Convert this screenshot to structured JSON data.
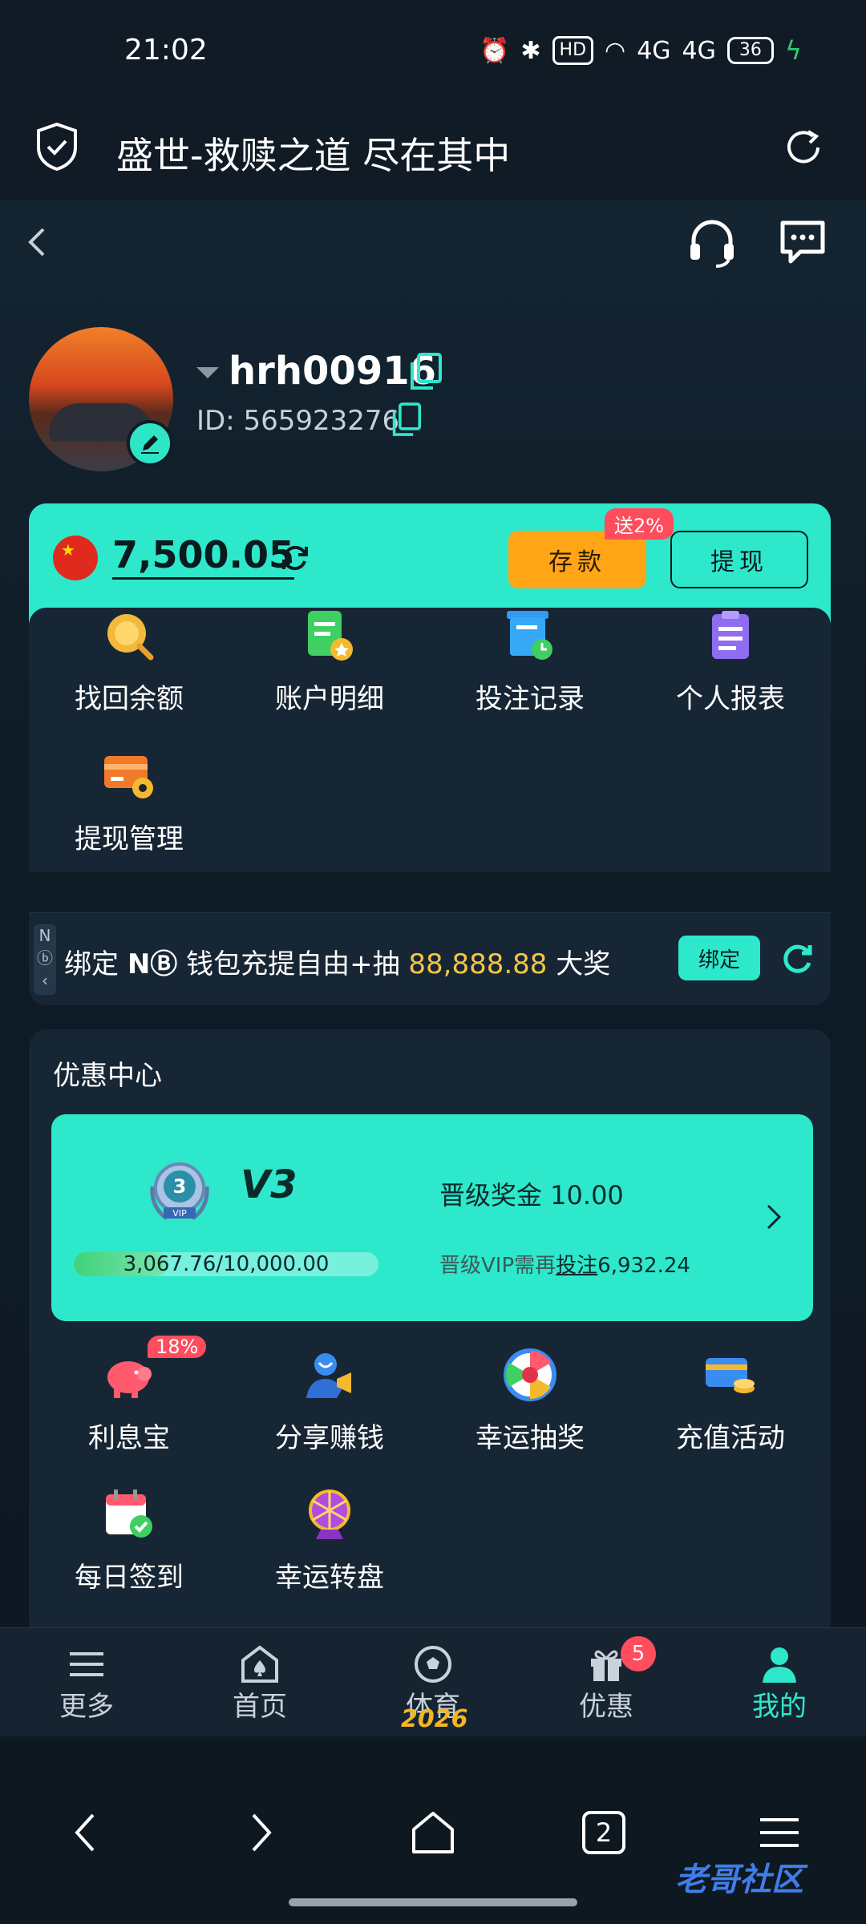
{
  "status_bar": {
    "time": "21:02",
    "hd_label": "HD",
    "signal_1": "4G",
    "signal_2": "4G",
    "battery": "36"
  },
  "browser": {
    "title": "盛世-救赎之道 尽在其中"
  },
  "user": {
    "username": "hrh00916",
    "id_text": "ID: 565923276"
  },
  "wallet": {
    "balance": "7,500.05",
    "deposit_label": "存款",
    "deposit_bonus": "送2%",
    "withdraw_label": "提现"
  },
  "menu": [
    {
      "label": "找回余额",
      "icon": "coin-search-icon"
    },
    {
      "label": "账户明细",
      "icon": "account-detail-icon"
    },
    {
      "label": "投注记录",
      "icon": "bet-record-icon"
    },
    {
      "label": "个人报表",
      "icon": "report-clipboard-icon"
    },
    {
      "label": "提现管理",
      "icon": "withdraw-card-icon"
    }
  ],
  "bind": {
    "side_text": "N",
    "prefix": "绑定 ",
    "brand": "NⒷ",
    "middle": " 钱包充提自由+抽 ",
    "amount": "88,888.88",
    "suffix": " 大奖",
    "button": "绑定"
  },
  "promo": {
    "title": "优惠中心",
    "vip": {
      "badge_number": "3",
      "badge_text": "VIP",
      "level": "V3",
      "progress_text": "3,067.76/10,000.00",
      "progress_fraction": 0.3068,
      "bonus_text": "晋级奖金 10.00",
      "need_prefix": "晋级VIP需再",
      "need_link": "投注",
      "need_amount": "6,932.24"
    },
    "items": [
      {
        "label": "利息宝",
        "icon": "piggy-bank-icon",
        "tag": "18%"
      },
      {
        "label": "分享赚钱",
        "icon": "share-megaphone-icon"
      },
      {
        "label": "幸运抽奖",
        "icon": "lucky-wheel-icon"
      },
      {
        "label": "充值活动",
        "icon": "card-coin-icon"
      },
      {
        "label": "每日签到",
        "icon": "calendar-check-icon"
      },
      {
        "label": "幸运转盘",
        "icon": "spin-wheel-icon"
      }
    ]
  },
  "app_nav": [
    {
      "label": "更多",
      "icon": "menu-lines-icon"
    },
    {
      "label": "首页",
      "icon": "home-spade-icon"
    },
    {
      "label": "体育",
      "icon": "soccer-ball-icon"
    },
    {
      "label": "优惠",
      "icon": "gift-icon",
      "badge": "5"
    },
    {
      "label": "我的",
      "icon": "user-icon",
      "active": true
    }
  ],
  "deco_year": "2026",
  "watermark": "老哥社区",
  "system_nav": {
    "tabs_count": "2"
  },
  "colors": {
    "accent": "#2ee8cc",
    "deposit": "#ffa516",
    "badge": "#ff4d5e",
    "amount": "#f5c542"
  }
}
